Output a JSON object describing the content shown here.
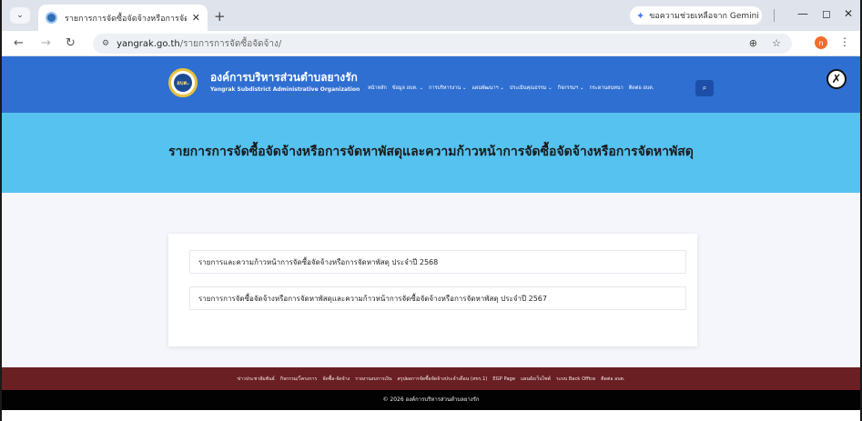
{
  "browser": {
    "tab_title": "รายการการจัดซื้อจัดจ้างหรือการจัด...",
    "gemini_label": "ขอความช่วยเหลือจาก Gemini",
    "url_host": "yangrak.go.th",
    "url_path": "/รายการการจัดซื้อจัดจ้าง/",
    "profile_initial": "n"
  },
  "site": {
    "org_name": "องค์การบริหารส่วนตำบลยางรัก",
    "org_name_en": "Yangrak Subdistrict Administrative Organization",
    "logo_text": "อบต.",
    "nav": [
      "หน้าหลัก",
      "ข้อมูล อบต. ⌄",
      "การบริหารงาน ⌄",
      "แผนพัฒนาฯ ⌄",
      "ประเมินคุณธรรม ⌄",
      "กิจกรรมฯ ⌄",
      "กระดานสนทนา",
      "ติดต่อ อบต."
    ]
  },
  "hero": {
    "title": "รายการการจัดซื้อจัดจ้างหรือการจัดหาพัสดุและความก้าวหน้าการจัดซื้อจัดจ้างหรือการจัดหาพัสดุ"
  },
  "documents": [
    "รายการและความก้าวหน้าการจัดซื้อจัดจ้างหรือการจัดหาพัสดุ ประจำปี 2568",
    "รายการการจัดซื้อจัดจ้างหรือการจัดหาพัสดุและความก้าวหน้าการจัดซื้อจัดจ้างหรือการจัดหาพัสดุ ประจำปี 2567"
  ],
  "footer": {
    "links": [
      "ข่าวประชาสัมพันธ์",
      "กิจกรรม/โครงการ",
      "จัดซื้อ-จัดจ้าง",
      "รายงานงบการเงิน",
      "สรุปผลการจัดซื้อจัดจ้างประจำเดือน (สขร.1)",
      "EGP Page",
      "แผนผังเว็บไซต์",
      "ระบบ Back Office",
      "ติดต่อ อบต."
    ],
    "copyright": "© 2026 องค์การบริหารส่วนตำบลยางรัก"
  },
  "colors": {
    "header_blue": "#2f6fd2",
    "hero_blue": "#55c2f0",
    "footer_maroon": "#6a1f23"
  }
}
